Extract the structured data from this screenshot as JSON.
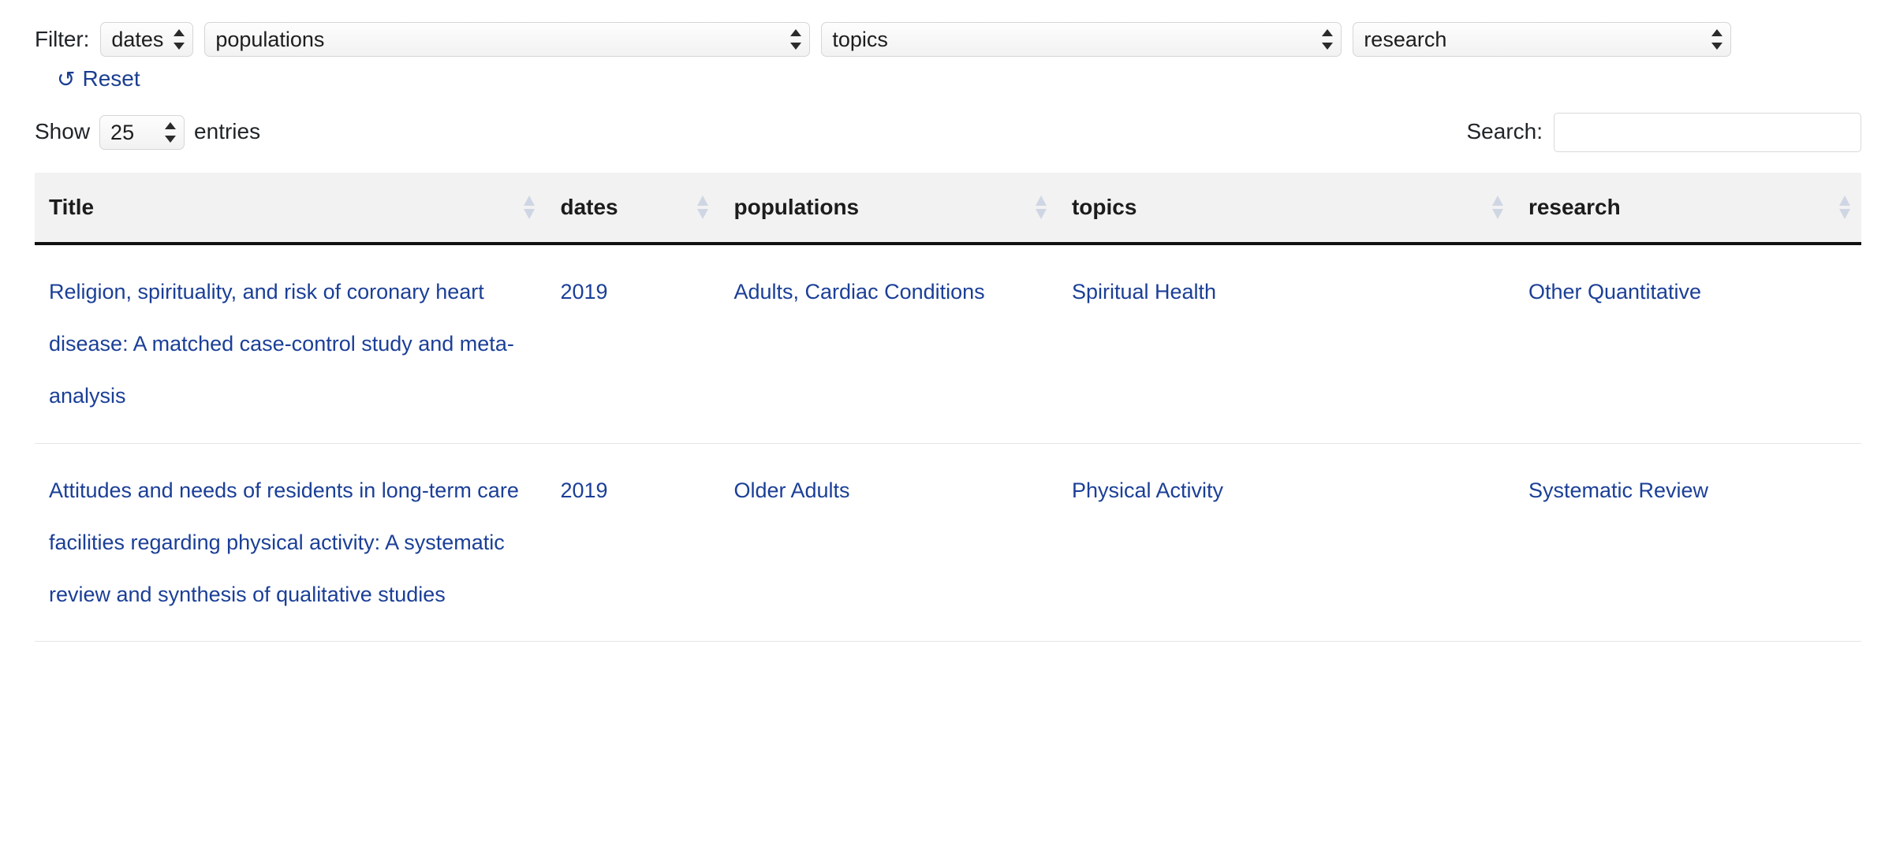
{
  "filters": {
    "label": "Filter:",
    "selects": [
      {
        "name": "dates",
        "value": "dates"
      },
      {
        "name": "populations",
        "value": "populations"
      },
      {
        "name": "topics",
        "value": "topics"
      },
      {
        "name": "research",
        "value": "research"
      }
    ],
    "reset": {
      "label": "Reset",
      "icon": "undo-arrow-icon",
      "glyph": "↺",
      "color": "#1a3e91"
    }
  },
  "controls": {
    "show_label": "Show",
    "entries_label": "entries",
    "page_length": "25",
    "page_length_options": [
      "10",
      "25",
      "50",
      "100"
    ],
    "search_label": "Search:",
    "search_value": "",
    "search_placeholder": ""
  },
  "table": {
    "columns": [
      {
        "label": "Title",
        "sortable": true
      },
      {
        "label": "dates",
        "sortable": true
      },
      {
        "label": "populations",
        "sortable": true
      },
      {
        "label": "topics",
        "sortable": true
      },
      {
        "label": "research",
        "sortable": true
      }
    ],
    "rows": [
      {
        "title": "Religion, spirituality, and risk of coronary heart disease: A matched case-control study and meta-analysis",
        "dates": "2019",
        "populations": "Adults, Cardiac Conditions",
        "topics": "Spiritual Health",
        "research": "Other Quantitative"
      },
      {
        "title": "Attitudes and needs of residents in long-term care facilities regarding physical activity: A systematic review and synthesis of qualitative studies",
        "dates": "2019",
        "populations": "Older Adults",
        "topics": "Physical Activity",
        "research": "Systematic Review"
      }
    ]
  },
  "colors": {
    "link": "#1b3f97",
    "reset_link": "#1a3e91",
    "header_bg": "#f2f2f2",
    "header_border": "#111111",
    "row_border": "#e6e6e6"
  }
}
